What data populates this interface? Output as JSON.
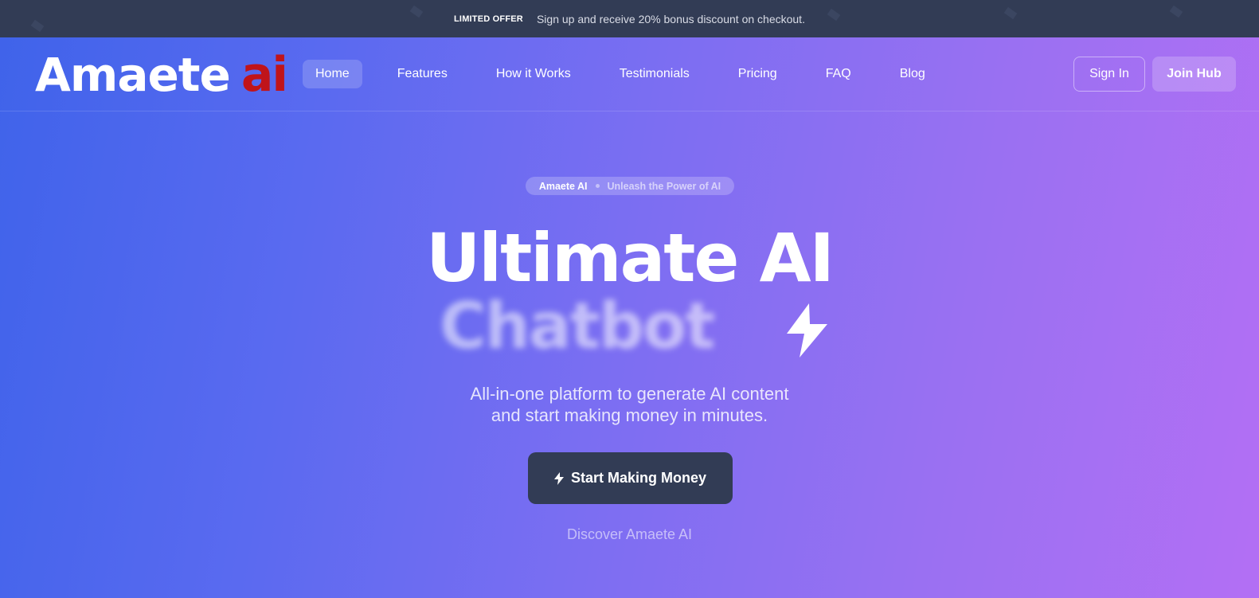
{
  "announcement": {
    "tag": "LIMITED OFFER",
    "text": "Sign up and receive 20% bonus discount on checkout."
  },
  "brand": {
    "name": "Amaete",
    "suffix": "ai",
    "suffix_color": "#c0141a"
  },
  "nav": {
    "items": [
      {
        "label": "Home",
        "active": true
      },
      {
        "label": "Features"
      },
      {
        "label": "How it Works"
      },
      {
        "label": "Testimonials"
      },
      {
        "label": "Pricing"
      },
      {
        "label": "FAQ"
      },
      {
        "label": "Blog"
      }
    ]
  },
  "auth": {
    "sign_in": "Sign In",
    "join": "Join Hub"
  },
  "hero": {
    "pill_brand": "Amaete AI",
    "pill_tagline": "Unleash the Power of AI",
    "title": "Ultimate AI",
    "rotating_word": "Chatbot",
    "subtitle_line1": "All-in-one platform to generate AI content",
    "subtitle_line2": "and start making money in minutes.",
    "cta_label": "Start Making Money",
    "cta_icon": "bolt-icon",
    "secondary_link": "Discover Amaete AI"
  },
  "colors": {
    "topbar": "#323c55",
    "gradient_start": "#3f63ea",
    "gradient_end": "#b36ff4",
    "cta_bg": "#323c55"
  }
}
